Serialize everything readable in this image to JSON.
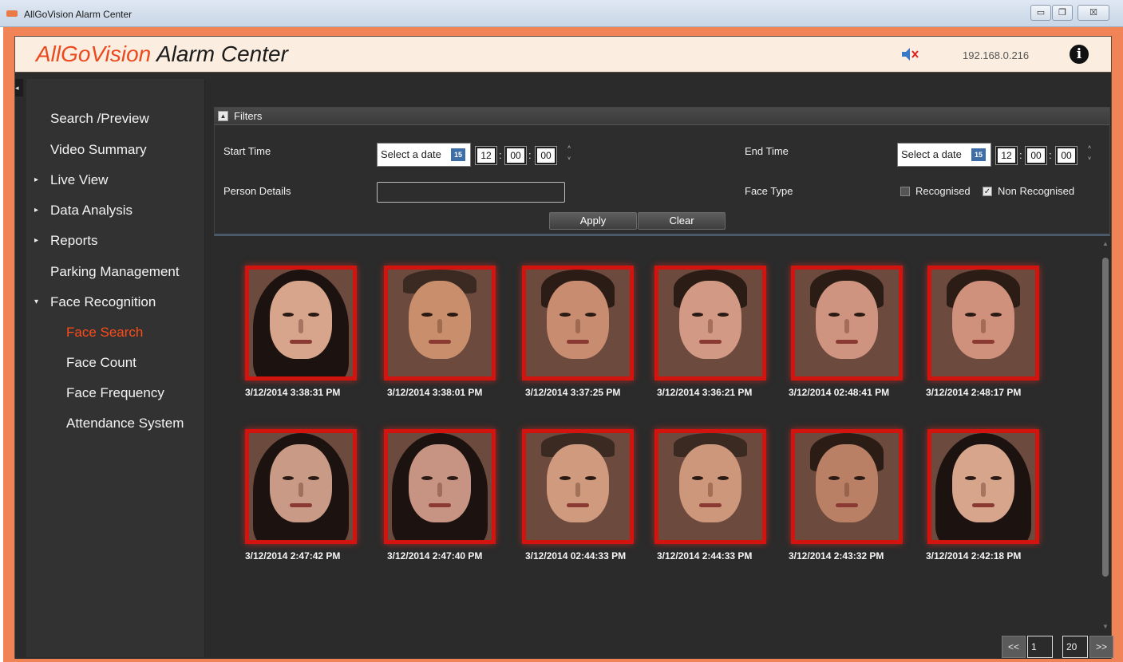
{
  "window": {
    "title": "AllGoVision Alarm Center",
    "min": "▭",
    "max": "❐",
    "close": "☒"
  },
  "header": {
    "brand_accent": "AllGoVision",
    "brand_rest": " Alarm Center",
    "ip": "192.168.0.216",
    "info": "i",
    "mute_icon": "speaker-muted-icon"
  },
  "sidebar": {
    "items": [
      {
        "label": "Search /Preview",
        "caret": ""
      },
      {
        "label": "Video Summary",
        "caret": ""
      },
      {
        "label": "Live View",
        "caret": "▸"
      },
      {
        "label": "Data Analysis",
        "caret": "▸"
      },
      {
        "label": "Reports",
        "caret": "▸"
      },
      {
        "label": "Parking Management",
        "caret": ""
      },
      {
        "label": "Face Recognition",
        "caret": "▾"
      },
      {
        "label": "Face Search",
        "caret": ""
      },
      {
        "label": "Face Count",
        "caret": ""
      },
      {
        "label": "Face Frequency",
        "caret": ""
      },
      {
        "label": "Attendance System",
        "caret": ""
      }
    ],
    "active_index": 7
  },
  "filters": {
    "title": "Filters",
    "start_label": "Start Time",
    "end_label": "End Time",
    "person_label": "Person Details",
    "face_type_label": "Face Type",
    "date_placeholder": "Select a date",
    "cal_day": "15",
    "hour": "12",
    "minute": "00",
    "second": "00",
    "recognised_label": "Recognised",
    "recognised_checked": false,
    "non_recognised_label": "Non Recognised",
    "non_recognised_checked": true,
    "person_value": "",
    "apply": "Apply",
    "clear": "Clear"
  },
  "results": [
    {
      "time": "3/12/2014  3:38:31 PM",
      "hair": "long",
      "skin": "#d6a58c"
    },
    {
      "time": "3/12/2014  3:38:01 PM",
      "hair": "bald",
      "skin": "#c98f6d"
    },
    {
      "time": "3/12/2014  3:37:25 PM",
      "hair": "short",
      "skin": "#c88c70"
    },
    {
      "time": "3/12/2014  3:36:21 PM",
      "hair": "short",
      "skin": "#d29a84"
    },
    {
      "time": "3/12/2014  02:48:41 PM",
      "hair": "short",
      "skin": "#cf9480"
    },
    {
      "time": "3/12/2014  2:48:17 PM",
      "hair": "short",
      "skin": "#d0917c"
    },
    {
      "time": "3/12/2014  2:47:42 PM",
      "hair": "long",
      "skin": "#c99a86"
    },
    {
      "time": "3/12/2014  2:47:40 PM",
      "hair": "long",
      "skin": "#c79483"
    },
    {
      "time": "3/12/2014  02:44:33 PM",
      "hair": "bald",
      "skin": "#cf9a7e"
    },
    {
      "time": "3/12/2014  2:44:33 PM",
      "hair": "bald",
      "skin": "#cc977b"
    },
    {
      "time": "3/12/2014  2:43:32 PM",
      "hair": "short",
      "skin": "#b98066"
    },
    {
      "time": "3/12/2014  2:42:18 PM",
      "hair": "long",
      "skin": "#d7a58c"
    }
  ],
  "pager": {
    "prev": "<<",
    "current": "1",
    "total": "20",
    "next": ">>"
  },
  "colors": {
    "accent": "#ea4a1d",
    "frame": "#f08457",
    "thumb_border": "#d3140e",
    "active_nav": "#ff4b17"
  }
}
